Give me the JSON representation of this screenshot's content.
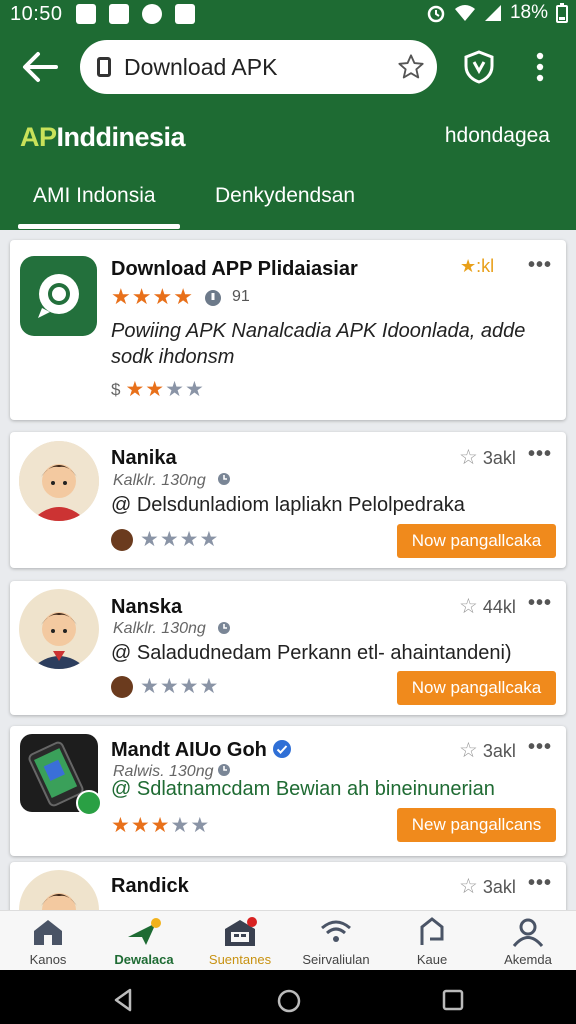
{
  "statusbar": {
    "time": "10:50",
    "battery": "18%"
  },
  "browser": {
    "url_text": "Download APK"
  },
  "header": {
    "brand_accent": "AP",
    "brand_rest": "Inddinesia",
    "right_link": "hdondagea"
  },
  "tabs": [
    {
      "label": "AMI Indonsia"
    },
    {
      "label": "Denkydendsan"
    }
  ],
  "featured": {
    "title": "Download APP Plidaiasiar",
    "rating_count": "91",
    "description_line1": "Powiing APK Nanalcadia APK Idoonlada, adde",
    "description_line2": "sodk ihdonsm",
    "top_rating": "★:kl",
    "rating_prefix": "$"
  },
  "items": [
    {
      "title": "Nanika",
      "meta": "Kalklr. 130ng",
      "description": "@ Delsdunladiom lapliakn Pelolpedraka",
      "rating_label": "3akl",
      "button": "Now pangallcaka"
    },
    {
      "title": "Nanska",
      "meta": "Kalklr. 130ng",
      "description": "@ Saladudnedam Perkann etl- ahaintandeni)",
      "rating_label": "44kl",
      "button": "Now pangallcaka"
    },
    {
      "title": "Mandt AIUo Goh",
      "meta": "Ralwis. 130ng",
      "description": "@ Sdlatnamcdam Bewian ah bineinunerian",
      "rating_label": "3akl",
      "button": "New pangallcans"
    },
    {
      "title": "Randick",
      "meta": "",
      "description": "",
      "rating_label": "3akl",
      "button": ""
    }
  ],
  "bottom_nav": [
    {
      "label": "Kanos",
      "icon": "home-icon"
    },
    {
      "label": "Dewalaca",
      "icon": "rocket-icon"
    },
    {
      "label": "Suentanes",
      "icon": "store-icon"
    },
    {
      "label": "Seirvaliulan",
      "icon": "wifi-icon"
    },
    {
      "label": "Kaue",
      "icon": "tag-icon"
    },
    {
      "label": "Akemda",
      "icon": "account-icon"
    }
  ],
  "colors": {
    "primary": "#1e6b33",
    "accent_orange": "#f08a1c",
    "star_orange": "#e8701a"
  }
}
